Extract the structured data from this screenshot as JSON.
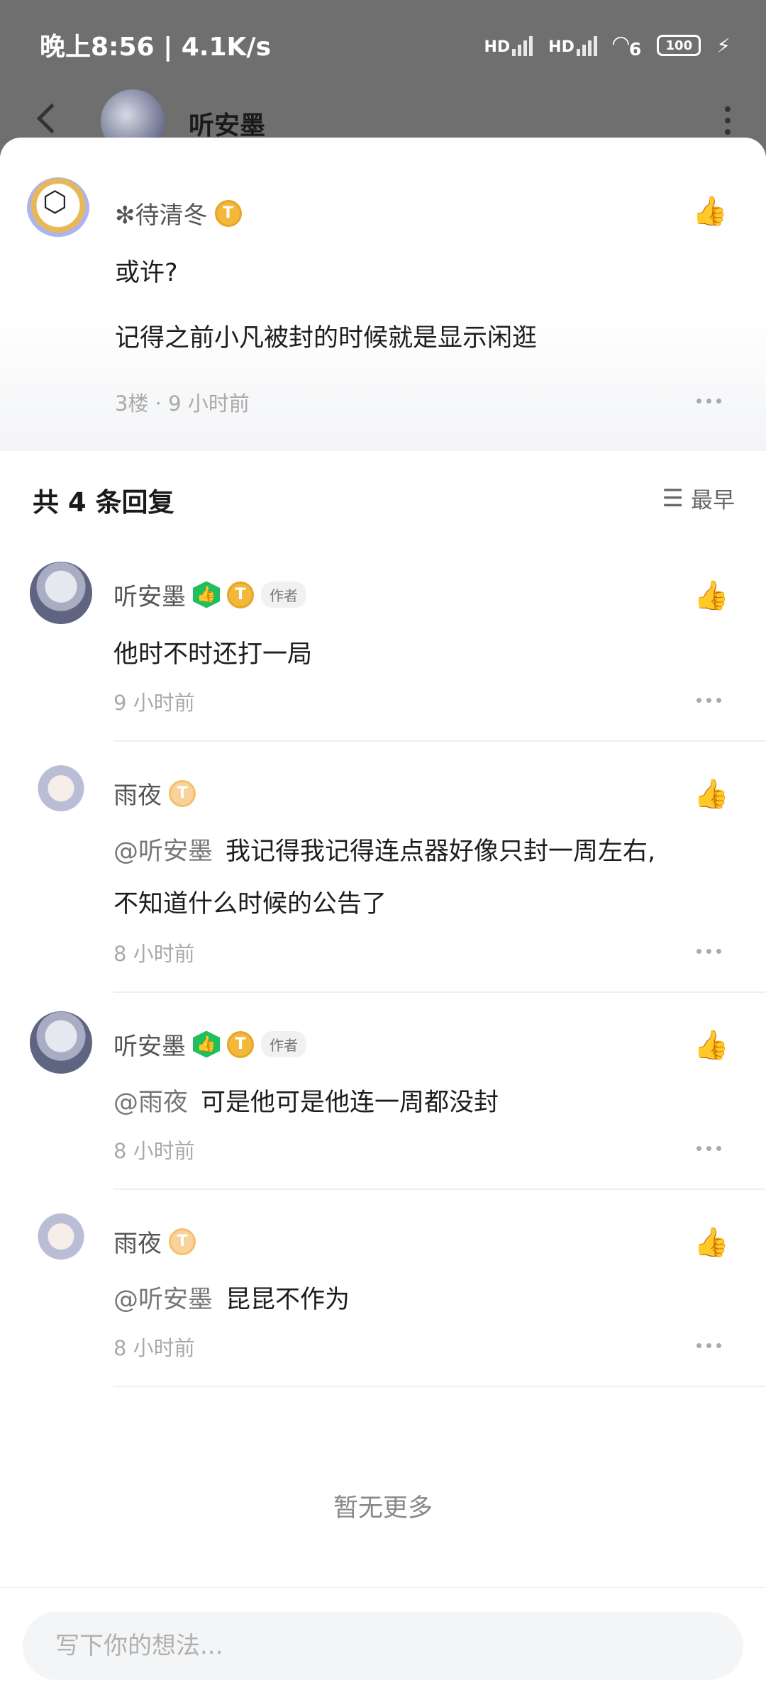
{
  "status_bar": {
    "time": "晚上8:56 | 4.1K/s",
    "signal1": "HD",
    "signal2": "HD",
    "wifi_tag": "6",
    "battery": "100"
  },
  "background": {
    "title": "听安墨"
  },
  "main_comment": {
    "username": "✻待清冬",
    "level": "T",
    "lines": [
      "或许?",
      "记得之前小凡被封的时候就是显示闲逛"
    ],
    "floor": "3楼 · 9 小时前"
  },
  "replies_header": {
    "title": "共 4 条回复",
    "sort_label": "最早"
  },
  "replies": [
    {
      "username": "听安墨",
      "level": "T",
      "author_tag": "作者",
      "mention": "",
      "text": "他时不时还打一局",
      "text2": "",
      "time": "9 小时前"
    },
    {
      "username": "雨夜",
      "level": "T",
      "author_tag": "",
      "mention": "@听安墨",
      "text": "我记得我记得连点器好像只封一周左右,",
      "text2": "不知道什么时候的公告了",
      "time": "8 小时前"
    },
    {
      "username": "听安墨",
      "level": "T",
      "author_tag": "作者",
      "mention": "@雨夜",
      "text": "可是他可是他连一周都没封",
      "text2": "",
      "time": "8 小时前"
    },
    {
      "username": "雨夜",
      "level": "T",
      "author_tag": "",
      "mention": "@听安墨",
      "text": "昆昆不作为",
      "text2": "",
      "time": "8 小时前"
    }
  ],
  "no_more": "暂无更多",
  "composer": {
    "placeholder": "写下你的想法..."
  }
}
